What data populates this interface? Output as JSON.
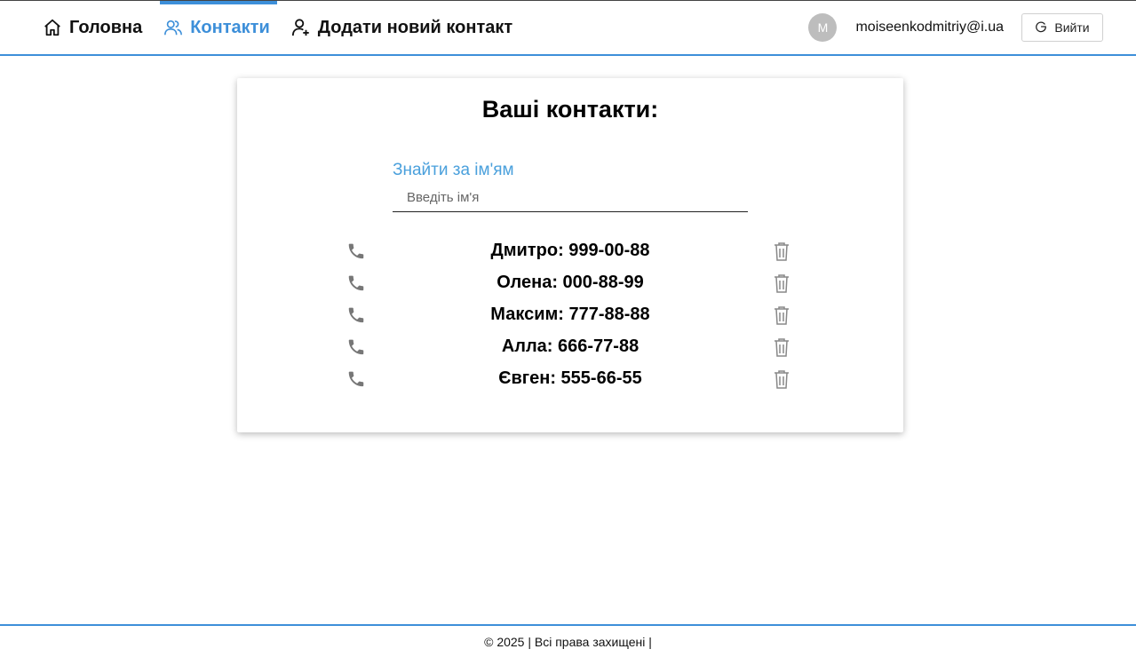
{
  "nav": {
    "items": [
      {
        "label": "Головна",
        "icon": "home-icon"
      },
      {
        "label": "Контакти",
        "icon": "contacts-icon"
      },
      {
        "label": "Додати новий контакт",
        "icon": "add-user-icon"
      }
    ],
    "active": "Контакти"
  },
  "user": {
    "avatar_letter": "M",
    "email": "moiseenkodmitriy@i.ua",
    "logout_label": "Вийти"
  },
  "contacts_page": {
    "title": "Ваші контакти:",
    "search_label": "Знайти за ім'ям",
    "search_placeholder": "Введіть ім'я",
    "search_value": "",
    "contacts": [
      {
        "text": "Дмитро: 999-00-88"
      },
      {
        "text": "Олена: 000-88-99"
      },
      {
        "text": "Максим: 777-88-88"
      },
      {
        "text": "Алла: 666-77-88"
      },
      {
        "text": "Євген: 555-66-55"
      }
    ]
  },
  "footer": {
    "text": "© 2025 | Всі права захищені |"
  },
  "colors": {
    "accent": "#3d8fd9",
    "search_label": "#4aa0dc",
    "icon_gray": "#777777"
  }
}
